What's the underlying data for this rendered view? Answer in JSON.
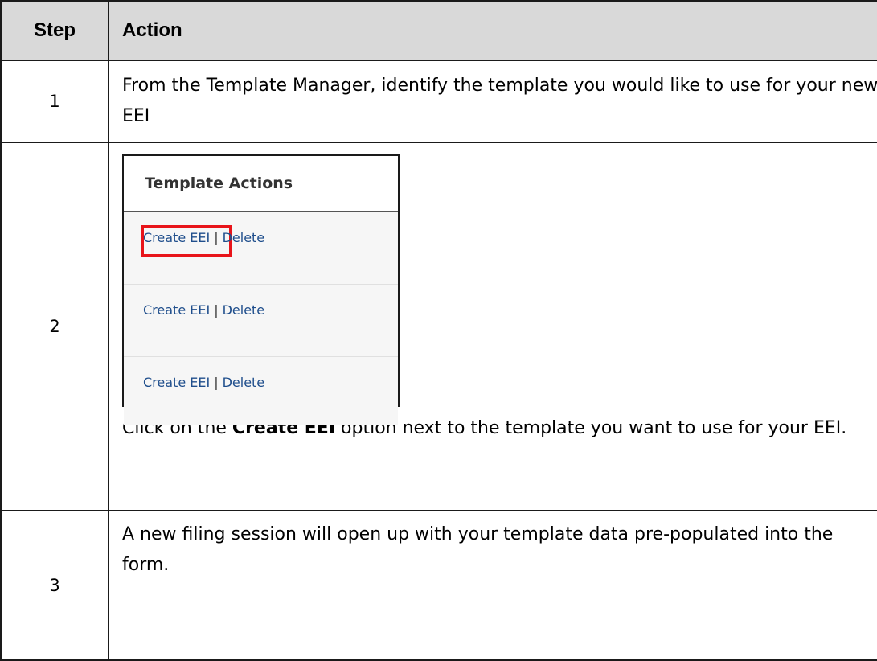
{
  "table": {
    "header": {
      "step": "Step",
      "action": "Action"
    },
    "rows": [
      {
        "step": "1",
        "text": "From the Template Manager, identify the template you would like to use for your new EEI"
      },
      {
        "step": "2",
        "panel": {
          "title": "Template Actions",
          "rows": [
            {
              "create": "Create EEI",
              "sep": "|",
              "delete": "Delete",
              "highlighted": true
            },
            {
              "create": "Create EEI",
              "sep": "|",
              "delete": "Delete",
              "highlighted": false
            },
            {
              "create": "Create EEI",
              "sep": "|",
              "delete": "Delete",
              "highlighted": false
            }
          ]
        },
        "text_before": "Click on the ",
        "text_bold": "Create EEI",
        "text_after": " option next to the template you want to use for your EEI."
      },
      {
        "step": "3",
        "text": "A new filing session will open up with your template data pre-populated into the form."
      }
    ]
  },
  "colors": {
    "header_bg": "#d9d9d9",
    "link": "#1f4e8c",
    "highlight": "#e8141a"
  }
}
